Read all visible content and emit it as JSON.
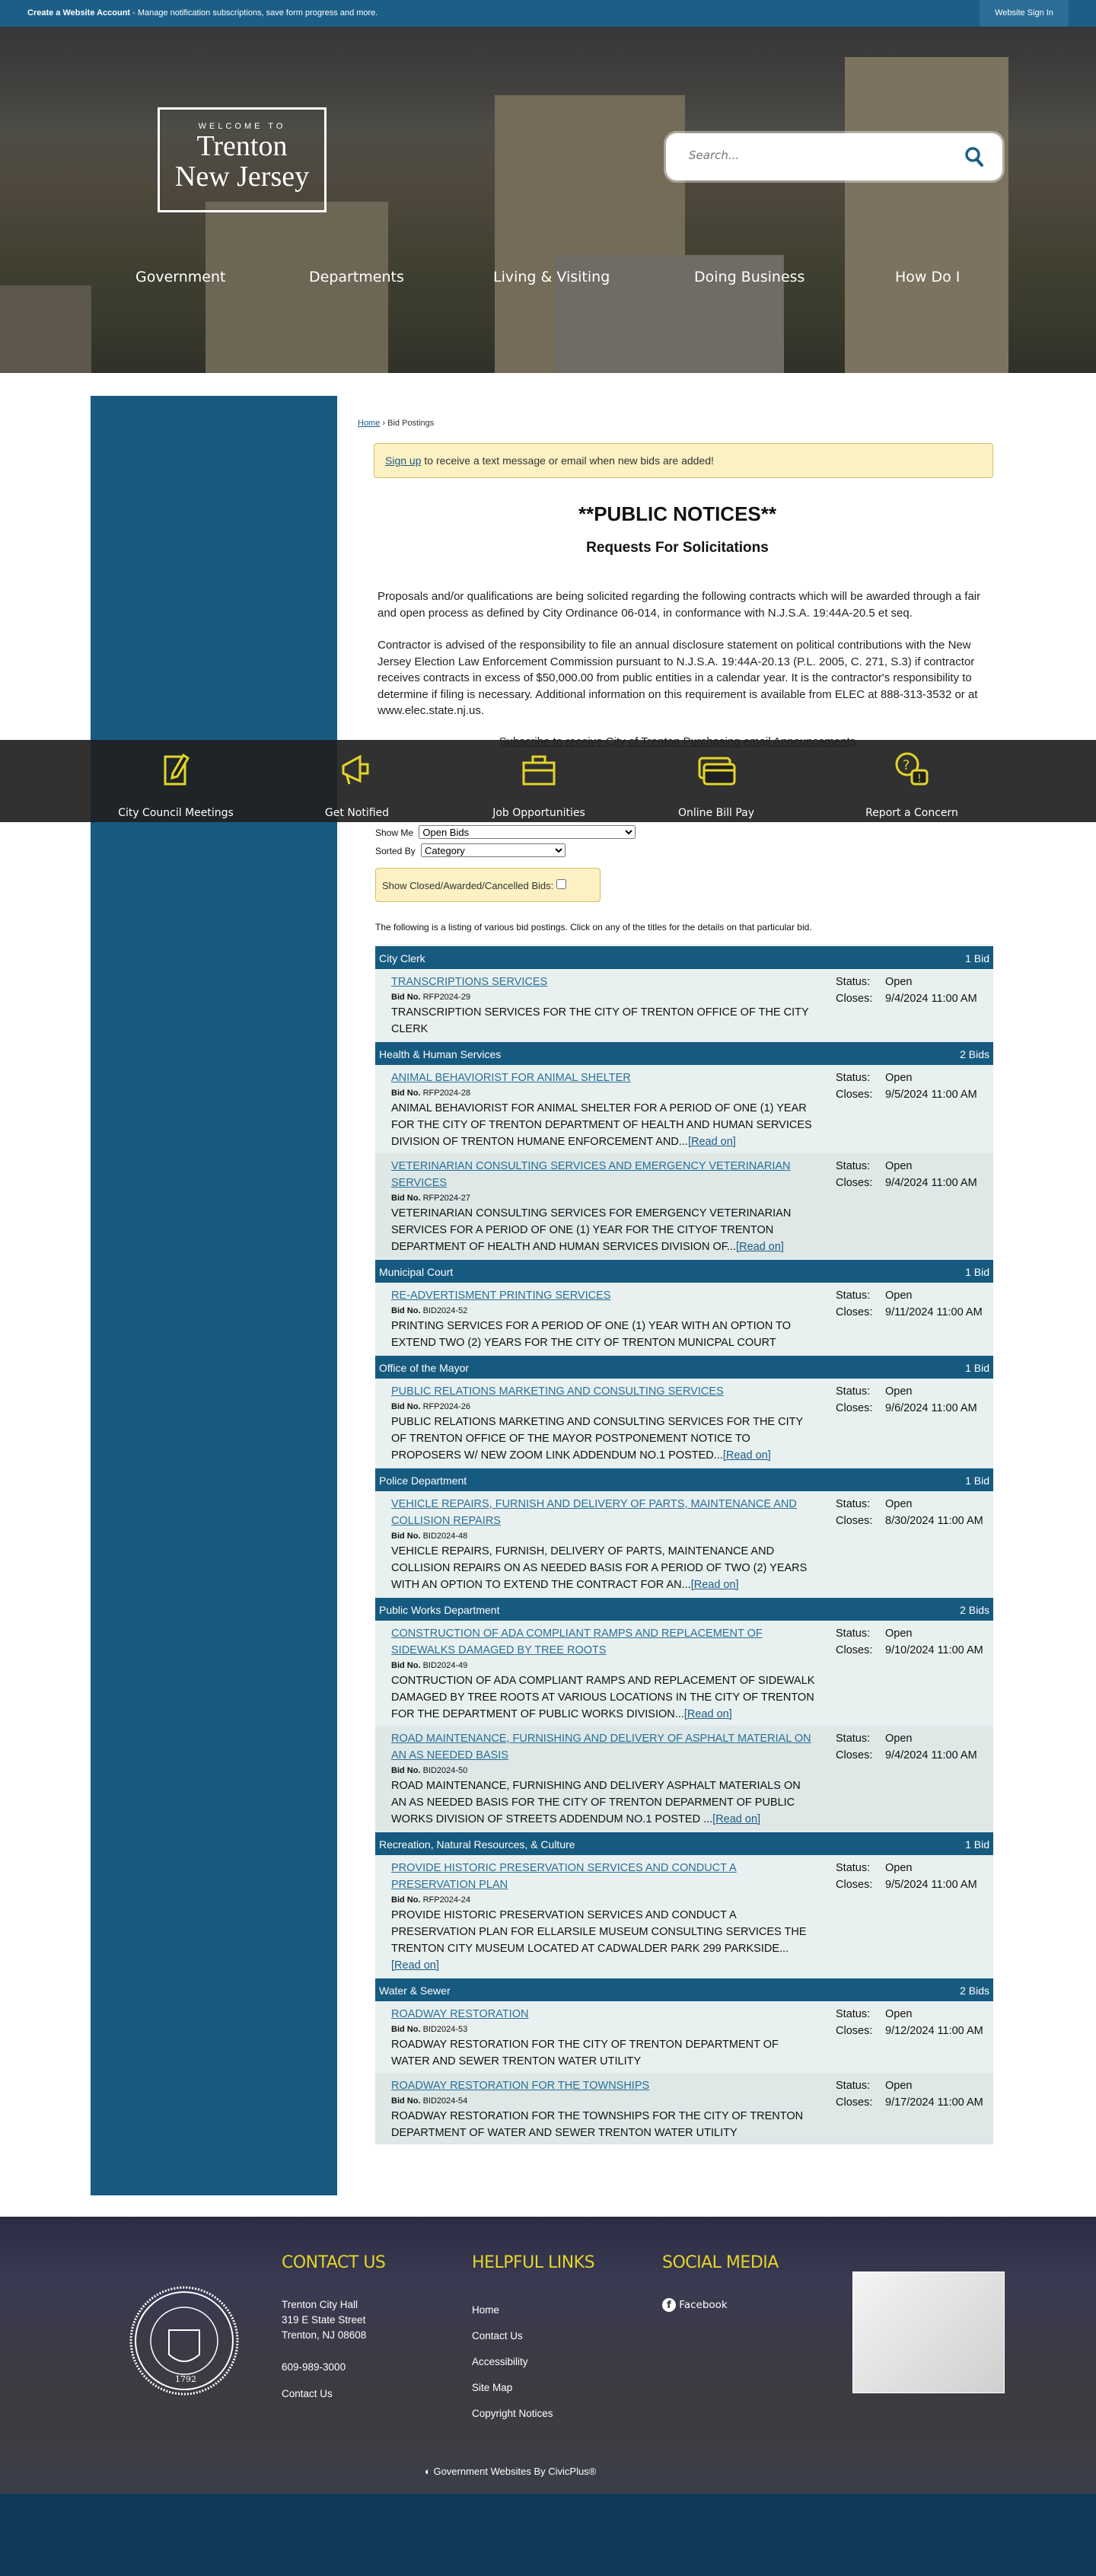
{
  "topbar": {
    "create_label": "Create a Website Account",
    "create_desc": " - Manage notification subscriptions, save form progress and more.",
    "signin": "Website Sign In"
  },
  "header": {
    "logo_welcome": "WELCOME TO",
    "logo_line1": "Trenton",
    "logo_line2": "New Jersey",
    "search_placeholder": "Search...",
    "search_icon": "magnifier-icon"
  },
  "nav": [
    "Government",
    "Departments",
    "Living & Visiting",
    "Doing Business",
    "How Do I"
  ],
  "breadcrumb": {
    "home": "Home",
    "sep": " › ",
    "current": "Bid Postings"
  },
  "alert": {
    "link": "Sign up",
    "text": " to receive a text message or email when new bids are added!"
  },
  "page": {
    "title": "**PUBLIC NOTICES**",
    "subtitle": "Requests For Solicitations",
    "para1": "Proposals and/or qualifications are being solicited regarding the following contracts which will be awarded through a fair and open process as defined by City Ordinance 06-014, in conformance with N.J.S.A. 19:44A-20.5 et seq.",
    "para2": "Contractor is advised of the responsibility to file an annual disclosure statement on political contributions with the New Jersey Election Law Enforcement Commission pursuant to N.J.S.A. 19:44A-20.13 (P.L. 2005, C. 271, S.3) if contractor receives contracts in excess of $50,000.00 from public entities in a calendar year. It is the contractor's responsibility to determine if filing is necessary. Additional information on this requirement is available from ELEC at 888-313-3532 or at www.elec.state.nj.us.",
    "subscribe": "Subscribe to receive City of Trenton Purchasing email Announcements"
  },
  "filters": {
    "show_label": "Show Me",
    "show_value": "Open Bids",
    "sort_label": "Sorted By",
    "sort_value": "Category",
    "closed_label": "Show Closed/Awarded/Cancelled Bids:",
    "closed_checked": false
  },
  "list_note": "The following is a listing of various bid postings. Click on any of the titles for the details on that particular bid.",
  "labels": {
    "bid_no": "Bid No.",
    "status": "Status:",
    "closes": "Closes:",
    "read_on": "[Read on]"
  },
  "categories": [
    {
      "name": "City Clerk",
      "count": "1 Bid",
      "bids": [
        {
          "title": "TRANSCRIPTIONS SERVICES",
          "bid_no": "RFP2024-29",
          "desc": "TRANSCRIPTION SERVICES FOR THE CITY OF TRENTON OFFICE OF THE CITY CLERK",
          "read_on": false,
          "status": "Open",
          "closes": "9/4/2024 11:00 AM"
        }
      ]
    },
    {
      "name": "Health & Human Services",
      "count": "2 Bids",
      "bids": [
        {
          "title": "ANIMAL BEHAVIORIST FOR ANIMAL SHELTER",
          "bid_no": "RFP2024-28",
          "desc": "ANIMAL BEHAVIORIST FOR ANIMAL SHELTER FOR A PERIOD OF ONE (1) YEAR FOR THE CITY OF TRENTON DEPARTMENT OF HEALTH AND HUMAN SERVICES DIVISION OF TRENTON HUMANE ENFORCEMENT AND...",
          "read_on": true,
          "status": "Open",
          "closes": "9/5/2024 11:00 AM"
        },
        {
          "title": "VETERINARIAN CONSULTING SERVICES AND EMERGENCY VETERINARIAN SERVICES",
          "bid_no": "RFP2024-27",
          "desc": "VETERINARIAN CONSULTING SERVICES FOR EMERGENCY VETERINARIAN SERVICES FOR A PERIOD OF ONE (1) YEAR FOR THE CITYOF TRENTON DEPARTMENT OF HEALTH AND HUMAN SERVICES DIVISION OF...",
          "read_on": true,
          "status": "Open",
          "closes": "9/4/2024 11:00 AM"
        }
      ]
    },
    {
      "name": "Municipal Court",
      "count": "1 Bid",
      "bids": [
        {
          "title": "RE-ADVERTISMENT PRINTING SERVICES",
          "bid_no": "BID2024-52",
          "desc": "PRINTING SERVICES FOR A PERIOD OF ONE (1) YEAR WITH AN OPTION TO EXTEND TWO (2) YEARS FOR THE CITY OF TRENTON MUNICPAL COURT",
          "read_on": false,
          "status": "Open",
          "closes": "9/11/2024 11:00 AM"
        }
      ]
    },
    {
      "name": "Office of the Mayor",
      "count": "1 Bid",
      "bids": [
        {
          "title": "PUBLIC RELATIONS MARKETING AND CONSULTING SERVICES",
          "bid_no": "RFP2024-26",
          "desc": "PUBLIC RELATIONS MARKETING AND CONSULTING SERVICES FOR THE CITY OF TRENTON OFFICE OF THE MAYOR POSTPONEMENT NOTICE TO PROPOSERS W/ NEW ZOOM LINK ADDENDUM NO.1 POSTED...",
          "read_on": true,
          "status": "Open",
          "closes": "9/6/2024 11:00 AM"
        }
      ]
    },
    {
      "name": "Police Department",
      "count": "1 Bid",
      "bids": [
        {
          "title": "VEHICLE REPAIRS, FURNISH AND DELIVERY OF PARTS, MAINTENANCE AND COLLISION REPAIRS",
          "bid_no": "BID2024-48",
          "desc": "VEHICLE REPAIRS, FURNISH, DELIVERY OF PARTS, MAINTENANCE AND COLLISION REPAIRS ON AS NEEDED BASIS FOR A PERIOD OF TWO (2) YEARS WITH AN OPTION TO EXTEND THE CONTRACT FOR AN...",
          "read_on": true,
          "status": "Open",
          "closes": "8/30/2024 11:00 AM"
        }
      ]
    },
    {
      "name": "Public Works Department",
      "count": "2 Bids",
      "bids": [
        {
          "title": "CONSTRUCTION OF ADA COMPLIANT RAMPS AND REPLACEMENT OF SIDEWALKS DAMAGED BY TREE ROOTS",
          "bid_no": "BID2024-49",
          "desc": "CONTRUCTION OF ADA COMPLIANT RAMPS AND REPLACEMENT OF SIDEWALK DAMAGED BY TREE ROOTS AT VARIOUS LOCATIONS IN THE CITY OF TRENTON FOR THE DEPARTMENT OF PUBLIC WORKS DIVISION...",
          "read_on": true,
          "status": "Open",
          "closes": "9/10/2024 11:00 AM"
        },
        {
          "title": "ROAD MAINTENANCE, FURNISHING AND DELIVERY OF ASPHALT MATERIAL ON AN AS NEEDED BASIS",
          "bid_no": "BID2024-50",
          "desc": "ROAD MAINTENANCE, FURNISHING AND DELIVERY ASPHALT MATERIALS ON AN AS NEEDED BASIS FOR THE CITY OF TRENTON DEPARMENT OF PUBLIC WORKS DIVISION OF STREETS ADDENDUM NO.1 POSTED ...",
          "read_on": true,
          "status": "Open",
          "closes": "9/4/2024 11:00 AM"
        }
      ]
    },
    {
      "name": "Recreation, Natural Resources, & Culture",
      "count": "1 Bid",
      "bids": [
        {
          "title": "PROVIDE HISTORIC PRESERVATION SERVICES AND CONDUCT A PRESERVATION PLAN",
          "bid_no": "RFP2024-24",
          "desc": "PROVIDE HISTORIC PRESERVATION SERVICES AND CONDUCT A PRESERVATION PLAN FOR ELLARSILE MUSEUM CONSULTING SERVICES THE TRENTON CITY MUSEUM LOCATED AT CADWALDER PARK 299 PARKSIDE...",
          "read_on": true,
          "status": "Open",
          "closes": "9/5/2024 11:00 AM"
        }
      ]
    },
    {
      "name": "Water & Sewer",
      "count": "2 Bids",
      "bids": [
        {
          "title": "ROADWAY RESTORATION",
          "bid_no": "BID2024-53",
          "desc": "ROADWAY RESTORATION FOR THE CITY OF TRENTON DEPARTMENT OF WATER AND SEWER TRENTON WATER UTILITY",
          "read_on": false,
          "status": "Open",
          "closes": "9/12/2024 11:00 AM"
        },
        {
          "title": "ROADWAY RESTORATION FOR THE TOWNSHIPS",
          "bid_no": "BID2024-54",
          "desc": "ROADWAY RESTORATION FOR THE TOWNSHIPS FOR THE CITY OF TRENTON DEPARTMENT OF WATER AND SEWER TRENTON WATER UTILITY",
          "read_on": false,
          "status": "Open",
          "closes": "9/17/2024 11:00 AM"
        }
      ]
    }
  ],
  "quick_links": [
    {
      "label": "City Council Meetings",
      "icon": "pencil-note-icon"
    },
    {
      "label": "Get Notified",
      "icon": "megaphone-icon"
    },
    {
      "label": "Job Opportunities",
      "icon": "briefcase-icon"
    },
    {
      "label": "Online Bill Pay",
      "icon": "credit-card-icon"
    },
    {
      "label": "Report a Concern",
      "icon": "question-chat-icon"
    }
  ],
  "footer": {
    "seal_text": "SEAL OF THE CITY OF TRENTON 1792",
    "contact_heading": "CONTACT US",
    "address1": "Trenton City Hall",
    "address2": "319 E State Street",
    "address3": "Trenton, NJ 08608",
    "phone": "609-989-3000",
    "contact_link": "Contact Us",
    "links_heading": "HELPFUL LINKS",
    "links": [
      "Home",
      "Contact Us",
      "Accessibility",
      "Site Map",
      "Copyright Notices"
    ],
    "social_heading": "SOCIAL MEDIA",
    "facebook": "Facebook",
    "brand": "Government Websites By CivicPlus®"
  },
  "colors": {
    "brand_blue": "#175a80",
    "accent_yellow": "#e4d52a",
    "alert_bg": "#fbf1c2",
    "footer_bottom": "#0f3a5a"
  }
}
